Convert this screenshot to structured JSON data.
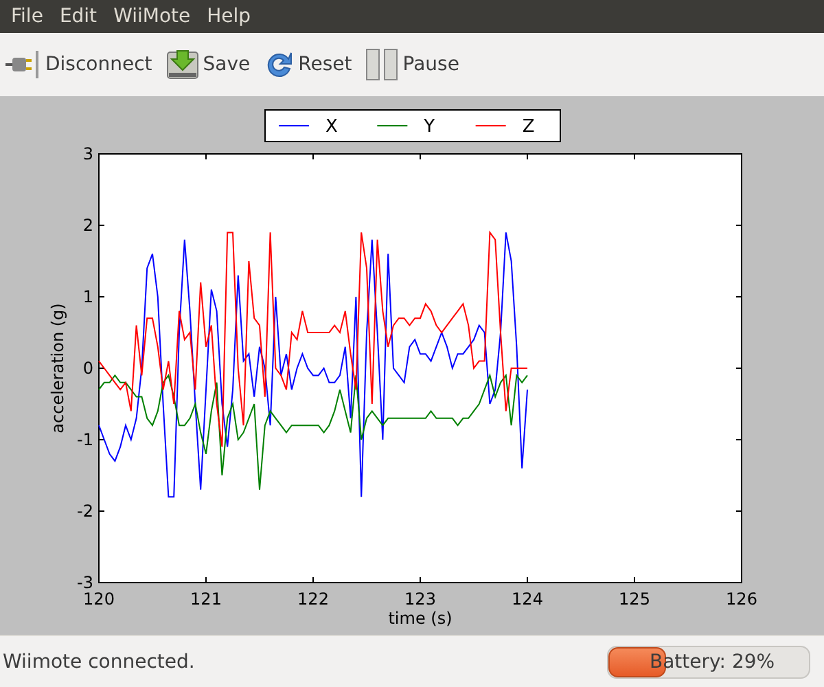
{
  "menu_bar": {
    "items": [
      "File",
      "Edit",
      "WiiMote",
      "Help"
    ]
  },
  "toolbar": {
    "buttons": [
      {
        "kind": "plug",
        "label": "Disconnect"
      },
      {
        "kind": "save",
        "label": "Save"
      },
      {
        "kind": "reset",
        "label": "Reset"
      },
      {
        "kind": "pause",
        "label": "Pause"
      }
    ]
  },
  "plot": {
    "chart_data": {
      "type": "line",
      "legend": "upper center",
      "xlabel": "time (s)",
      "ylabel": "acceleration (g)",
      "xlim": [
        120,
        126
      ],
      "ylim": [
        -3,
        3
      ],
      "xticks": [
        120,
        121,
        122,
        123,
        124,
        125,
        126
      ],
      "yticks": [
        -3,
        -2,
        -1,
        0,
        1,
        2,
        3
      ],
      "x": [
        120,
        120.05,
        120.1,
        120.15,
        120.2,
        120.25,
        120.3,
        120.35,
        120.4,
        120.45,
        120.5,
        120.55,
        120.6,
        120.65,
        120.7,
        120.75,
        120.8,
        120.85,
        120.9,
        120.95,
        121,
        121.05,
        121.1,
        121.15,
        121.2,
        121.25,
        121.3,
        121.35,
        121.4,
        121.45,
        121.5,
        121.55,
        121.6,
        121.65,
        121.7,
        121.75,
        121.8,
        121.85,
        121.9,
        121.95,
        122,
        122.05,
        122.1,
        122.15,
        122.2,
        122.25,
        122.3,
        122.35,
        122.4,
        122.45,
        122.5,
        122.55,
        122.6,
        122.65,
        122.7,
        122.75,
        122.8,
        122.85,
        122.9,
        122.95,
        123,
        123.05,
        123.1,
        123.15,
        123.2,
        123.25,
        123.3,
        123.35,
        123.4,
        123.45,
        123.5,
        123.55,
        123.6,
        123.65,
        123.7,
        123.75,
        123.8,
        123.85,
        123.9,
        123.95,
        124
      ],
      "series": [
        {
          "name": "X",
          "color": "#0000ff",
          "values": [
            -0.8,
            -1.0,
            -1.2,
            -1.3,
            -1.1,
            -0.8,
            -1.0,
            -0.7,
            0.0,
            1.4,
            1.6,
            1.0,
            -0.5,
            -1.8,
            -1.8,
            0.5,
            1.8,
            0.8,
            -0.5,
            -1.7,
            -0.3,
            1.1,
            0.8,
            -0.5,
            -1.1,
            -0.3,
            1.3,
            0.1,
            0.2,
            -0.4,
            0.3,
            0.0,
            -0.8,
            1.0,
            -0.1,
            0.2,
            -0.3,
            0.0,
            0.2,
            0.0,
            -0.1,
            -0.1,
            0.0,
            -0.2,
            -0.2,
            -0.1,
            0.3,
            -0.7,
            1.0,
            -1.8,
            0.5,
            1.8,
            0.5,
            -1.0,
            1.6,
            0.0,
            -0.1,
            -0.2,
            0.3,
            0.4,
            0.2,
            0.2,
            0.1,
            0.3,
            0.5,
            0.3,
            0.0,
            0.2,
            0.2,
            0.3,
            0.4,
            0.6,
            0.5,
            -0.5,
            -0.3,
            0.5,
            1.9,
            1.5,
            0.3,
            -1.4,
            -0.3
          ]
        },
        {
          "name": "Y",
          "color": "#008000",
          "values": [
            -0.3,
            -0.2,
            -0.2,
            -0.1,
            -0.2,
            -0.2,
            -0.3,
            -0.4,
            -0.4,
            -0.7,
            -0.8,
            -0.6,
            -0.2,
            -0.1,
            -0.4,
            -0.8,
            -0.8,
            -0.7,
            -0.5,
            -0.9,
            -1.2,
            -0.6,
            -0.2,
            -1.5,
            -0.7,
            -0.5,
            -1.0,
            -0.9,
            -0.7,
            -0.5,
            -1.7,
            -0.8,
            -0.6,
            -0.7,
            -0.8,
            -0.9,
            -0.8,
            -0.8,
            -0.8,
            -0.8,
            -0.8,
            -0.8,
            -0.9,
            -0.8,
            -0.6,
            -0.3,
            -0.6,
            -0.9,
            -0.1,
            -1.0,
            -0.7,
            -0.6,
            -0.7,
            -0.8,
            -0.7,
            -0.7,
            -0.7,
            -0.7,
            -0.7,
            -0.7,
            -0.7,
            -0.7,
            -0.6,
            -0.7,
            -0.7,
            -0.7,
            -0.7,
            -0.8,
            -0.7,
            -0.7,
            -0.6,
            -0.5,
            -0.3,
            -0.1,
            -0.4,
            -0.2,
            -0.1,
            -0.8,
            -0.1,
            -0.2,
            -0.1
          ]
        },
        {
          "name": "Z",
          "color": "#ff0000",
          "values": [
            0.1,
            0.0,
            -0.1,
            -0.2,
            -0.3,
            -0.2,
            -0.6,
            0.6,
            -0.1,
            0.7,
            0.7,
            0.3,
            -0.3,
            0.1,
            -0.5,
            0.8,
            0.4,
            0.5,
            -0.3,
            1.2,
            0.3,
            0.6,
            -0.5,
            -1.1,
            1.9,
            1.9,
            0.0,
            -0.8,
            1.5,
            0.7,
            0.6,
            -0.4,
            1.9,
            0.0,
            -0.1,
            -0.3,
            0.5,
            0.4,
            0.8,
            0.5,
            0.5,
            0.5,
            0.5,
            0.5,
            0.6,
            0.5,
            0.8,
            0.2,
            -0.3,
            1.9,
            1.4,
            -0.5,
            1.8,
            0.8,
            0.3,
            0.6,
            0.7,
            0.7,
            0.6,
            0.7,
            0.7,
            0.9,
            0.8,
            0.6,
            0.5,
            0.6,
            0.7,
            0.8,
            0.9,
            0.6,
            0.0,
            0.1,
            0.1,
            1.9,
            1.8,
            0.5,
            -0.6,
            0.0,
            0.0,
            0.0,
            0.0
          ]
        }
      ]
    }
  },
  "status_bar": {
    "message": "Wiimote connected.",
    "battery": {
      "label": "Battery: 29%",
      "level": 0.29
    }
  }
}
